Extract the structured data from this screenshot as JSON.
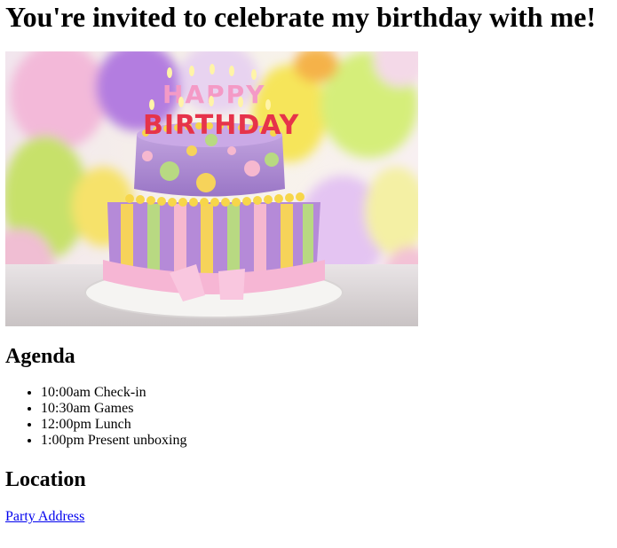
{
  "page": {
    "title": "You're invited to celebrate my birthday with me!"
  },
  "image": {
    "icon": "birthday-cake-photo",
    "cake_text_top": "HAPPY",
    "cake_text_bottom": "BIRTHDAY"
  },
  "agenda": {
    "heading": "Agenda",
    "items": [
      "10:00am Check-in",
      "10:30am Games",
      "12:00pm Lunch",
      "1:00pm Present unboxing"
    ]
  },
  "location": {
    "heading": "Location",
    "link_text": "Party Address"
  },
  "colors": {
    "link": "#0000ee",
    "text": "#000000",
    "background": "#ffffff"
  }
}
